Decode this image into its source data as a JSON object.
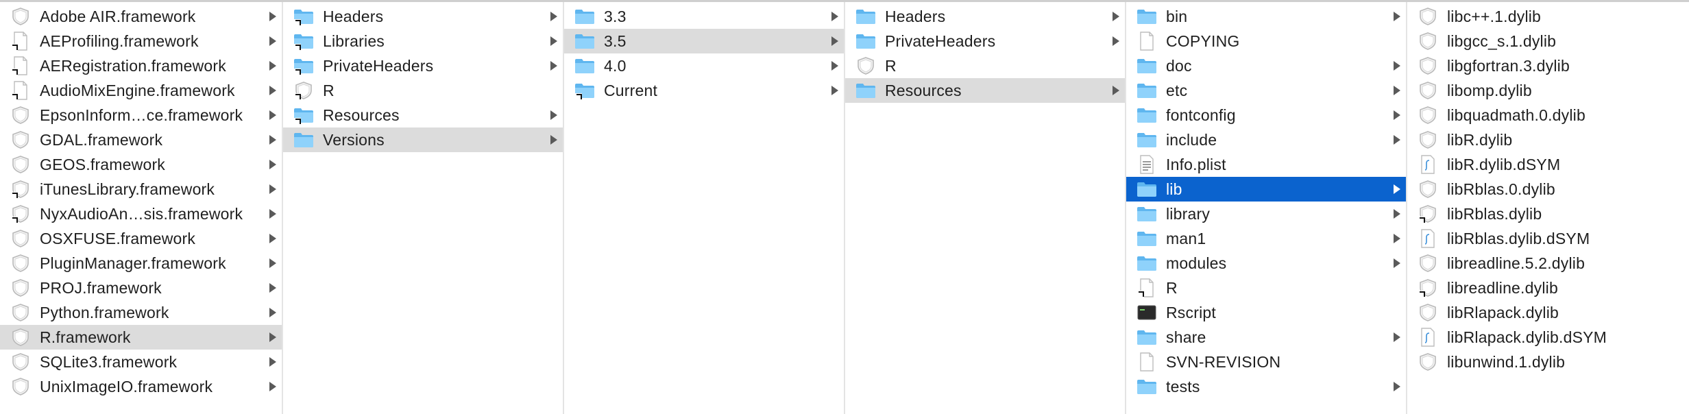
{
  "finder": {
    "columns": [
      {
        "items": [
          {
            "label": "Adobe AIR.framework",
            "icon": "framework-icon",
            "alias": false,
            "arrow": true,
            "selected": ""
          },
          {
            "label": "AEProfiling.framework",
            "icon": "document-icon",
            "alias": true,
            "arrow": true,
            "selected": ""
          },
          {
            "label": "AERegistration.framework",
            "icon": "document-icon",
            "alias": true,
            "arrow": true,
            "selected": ""
          },
          {
            "label": "AudioMixEngine.framework",
            "icon": "document-icon",
            "alias": true,
            "arrow": true,
            "selected": ""
          },
          {
            "label": "EpsonInform…ce.framework",
            "icon": "framework-icon",
            "alias": false,
            "arrow": true,
            "selected": ""
          },
          {
            "label": "GDAL.framework",
            "icon": "framework-icon",
            "alias": false,
            "arrow": true,
            "selected": ""
          },
          {
            "label": "GEOS.framework",
            "icon": "framework-icon",
            "alias": false,
            "arrow": true,
            "selected": ""
          },
          {
            "label": "iTunesLibrary.framework",
            "icon": "framework-icon",
            "alias": true,
            "arrow": true,
            "selected": ""
          },
          {
            "label": "NyxAudioAn…sis.framework",
            "icon": "framework-icon",
            "alias": true,
            "arrow": true,
            "selected": ""
          },
          {
            "label": "OSXFUSE.framework",
            "icon": "framework-icon",
            "alias": false,
            "arrow": true,
            "selected": ""
          },
          {
            "label": "PluginManager.framework",
            "icon": "framework-icon",
            "alias": false,
            "arrow": true,
            "selected": ""
          },
          {
            "label": "PROJ.framework",
            "icon": "framework-icon",
            "alias": false,
            "arrow": true,
            "selected": ""
          },
          {
            "label": "Python.framework",
            "icon": "framework-icon",
            "alias": false,
            "arrow": true,
            "selected": ""
          },
          {
            "label": "R.framework",
            "icon": "framework-icon",
            "alias": false,
            "arrow": true,
            "selected": "gray"
          },
          {
            "label": "SQLite3.framework",
            "icon": "framework-icon",
            "alias": false,
            "arrow": true,
            "selected": ""
          },
          {
            "label": "UnixImageIO.framework",
            "icon": "framework-icon",
            "alias": false,
            "arrow": true,
            "selected": ""
          }
        ]
      },
      {
        "items": [
          {
            "label": "Headers",
            "icon": "folder-icon",
            "alias": true,
            "arrow": true,
            "selected": ""
          },
          {
            "label": "Libraries",
            "icon": "folder-icon",
            "alias": true,
            "arrow": true,
            "selected": ""
          },
          {
            "label": "PrivateHeaders",
            "icon": "folder-icon",
            "alias": true,
            "arrow": true,
            "selected": ""
          },
          {
            "label": "R",
            "icon": "framework-icon",
            "alias": true,
            "arrow": false,
            "selected": ""
          },
          {
            "label": "Resources",
            "icon": "folder-icon",
            "alias": true,
            "arrow": true,
            "selected": ""
          },
          {
            "label": "Versions",
            "icon": "folder-icon",
            "alias": false,
            "arrow": true,
            "selected": "gray"
          }
        ]
      },
      {
        "items": [
          {
            "label": "3.3",
            "icon": "folder-icon",
            "alias": false,
            "arrow": true,
            "selected": ""
          },
          {
            "label": "3.5",
            "icon": "folder-icon",
            "alias": false,
            "arrow": true,
            "selected": "gray"
          },
          {
            "label": "4.0",
            "icon": "folder-icon",
            "alias": false,
            "arrow": true,
            "selected": ""
          },
          {
            "label": "Current",
            "icon": "folder-icon",
            "alias": true,
            "arrow": true,
            "selected": ""
          }
        ]
      },
      {
        "items": [
          {
            "label": "Headers",
            "icon": "folder-icon",
            "alias": false,
            "arrow": true,
            "selected": ""
          },
          {
            "label": "PrivateHeaders",
            "icon": "folder-icon",
            "alias": false,
            "arrow": true,
            "selected": ""
          },
          {
            "label": "R",
            "icon": "framework-icon",
            "alias": false,
            "arrow": false,
            "selected": ""
          },
          {
            "label": "Resources",
            "icon": "folder-icon",
            "alias": false,
            "arrow": true,
            "selected": "gray"
          }
        ]
      },
      {
        "items": [
          {
            "label": "bin",
            "icon": "folder-icon",
            "alias": false,
            "arrow": true,
            "selected": ""
          },
          {
            "label": "COPYING",
            "icon": "document-icon",
            "alias": false,
            "arrow": false,
            "selected": ""
          },
          {
            "label": "doc",
            "icon": "folder-icon",
            "alias": false,
            "arrow": true,
            "selected": ""
          },
          {
            "label": "etc",
            "icon": "folder-icon",
            "alias": false,
            "arrow": true,
            "selected": ""
          },
          {
            "label": "fontconfig",
            "icon": "folder-icon",
            "alias": false,
            "arrow": true,
            "selected": ""
          },
          {
            "label": "include",
            "icon": "folder-icon",
            "alias": false,
            "arrow": true,
            "selected": ""
          },
          {
            "label": "Info.plist",
            "icon": "plist-icon",
            "alias": false,
            "arrow": false,
            "selected": ""
          },
          {
            "label": "lib",
            "icon": "folder-icon",
            "alias": false,
            "arrow": true,
            "selected": "blue"
          },
          {
            "label": "library",
            "icon": "folder-icon",
            "alias": false,
            "arrow": true,
            "selected": ""
          },
          {
            "label": "man1",
            "icon": "folder-icon",
            "alias": false,
            "arrow": true,
            "selected": ""
          },
          {
            "label": "modules",
            "icon": "folder-icon",
            "alias": false,
            "arrow": true,
            "selected": ""
          },
          {
            "label": "R",
            "icon": "document-icon",
            "alias": true,
            "arrow": false,
            "selected": ""
          },
          {
            "label": "Rscript",
            "icon": "terminal-icon",
            "alias": false,
            "arrow": false,
            "selected": ""
          },
          {
            "label": "share",
            "icon": "folder-icon",
            "alias": false,
            "arrow": true,
            "selected": ""
          },
          {
            "label": "SVN-REVISION",
            "icon": "document-icon",
            "alias": false,
            "arrow": false,
            "selected": ""
          },
          {
            "label": "tests",
            "icon": "folder-icon",
            "alias": false,
            "arrow": true,
            "selected": ""
          }
        ]
      },
      {
        "items": [
          {
            "label": "libc++.1.dylib",
            "icon": "framework-icon",
            "alias": false,
            "arrow": false,
            "selected": ""
          },
          {
            "label": "libgcc_s.1.dylib",
            "icon": "framework-icon",
            "alias": false,
            "arrow": false,
            "selected": ""
          },
          {
            "label": "libgfortran.3.dylib",
            "icon": "framework-icon",
            "alias": false,
            "arrow": false,
            "selected": ""
          },
          {
            "label": "libomp.dylib",
            "icon": "framework-icon",
            "alias": false,
            "arrow": false,
            "selected": ""
          },
          {
            "label": "libquadmath.0.dylib",
            "icon": "framework-icon",
            "alias": false,
            "arrow": false,
            "selected": ""
          },
          {
            "label": "libR.dylib",
            "icon": "framework-icon",
            "alias": false,
            "arrow": false,
            "selected": ""
          },
          {
            "label": "libR.dylib.dSYM",
            "icon": "dsym-icon",
            "alias": false,
            "arrow": false,
            "selected": ""
          },
          {
            "label": "libRblas.0.dylib",
            "icon": "framework-icon",
            "alias": false,
            "arrow": false,
            "selected": ""
          },
          {
            "label": "libRblas.dylib",
            "icon": "framework-icon",
            "alias": true,
            "arrow": false,
            "selected": ""
          },
          {
            "label": "libRblas.dylib.dSYM",
            "icon": "dsym-icon",
            "alias": false,
            "arrow": false,
            "selected": ""
          },
          {
            "label": "libreadline.5.2.dylib",
            "icon": "framework-icon",
            "alias": false,
            "arrow": false,
            "selected": ""
          },
          {
            "label": "libreadline.dylib",
            "icon": "framework-icon",
            "alias": true,
            "arrow": false,
            "selected": ""
          },
          {
            "label": "libRlapack.dylib",
            "icon": "framework-icon",
            "alias": false,
            "arrow": false,
            "selected": ""
          },
          {
            "label": "libRlapack.dylib.dSYM",
            "icon": "dsym-icon",
            "alias": false,
            "arrow": false,
            "selected": ""
          },
          {
            "label": "libunwind.1.dylib",
            "icon": "framework-icon",
            "alias": false,
            "arrow": false,
            "selected": ""
          }
        ]
      }
    ],
    "colors": {
      "selection_blue": "#0b63ce",
      "selection_gray": "#dcdcdc",
      "folder_blue": "#6fc3f5"
    }
  }
}
